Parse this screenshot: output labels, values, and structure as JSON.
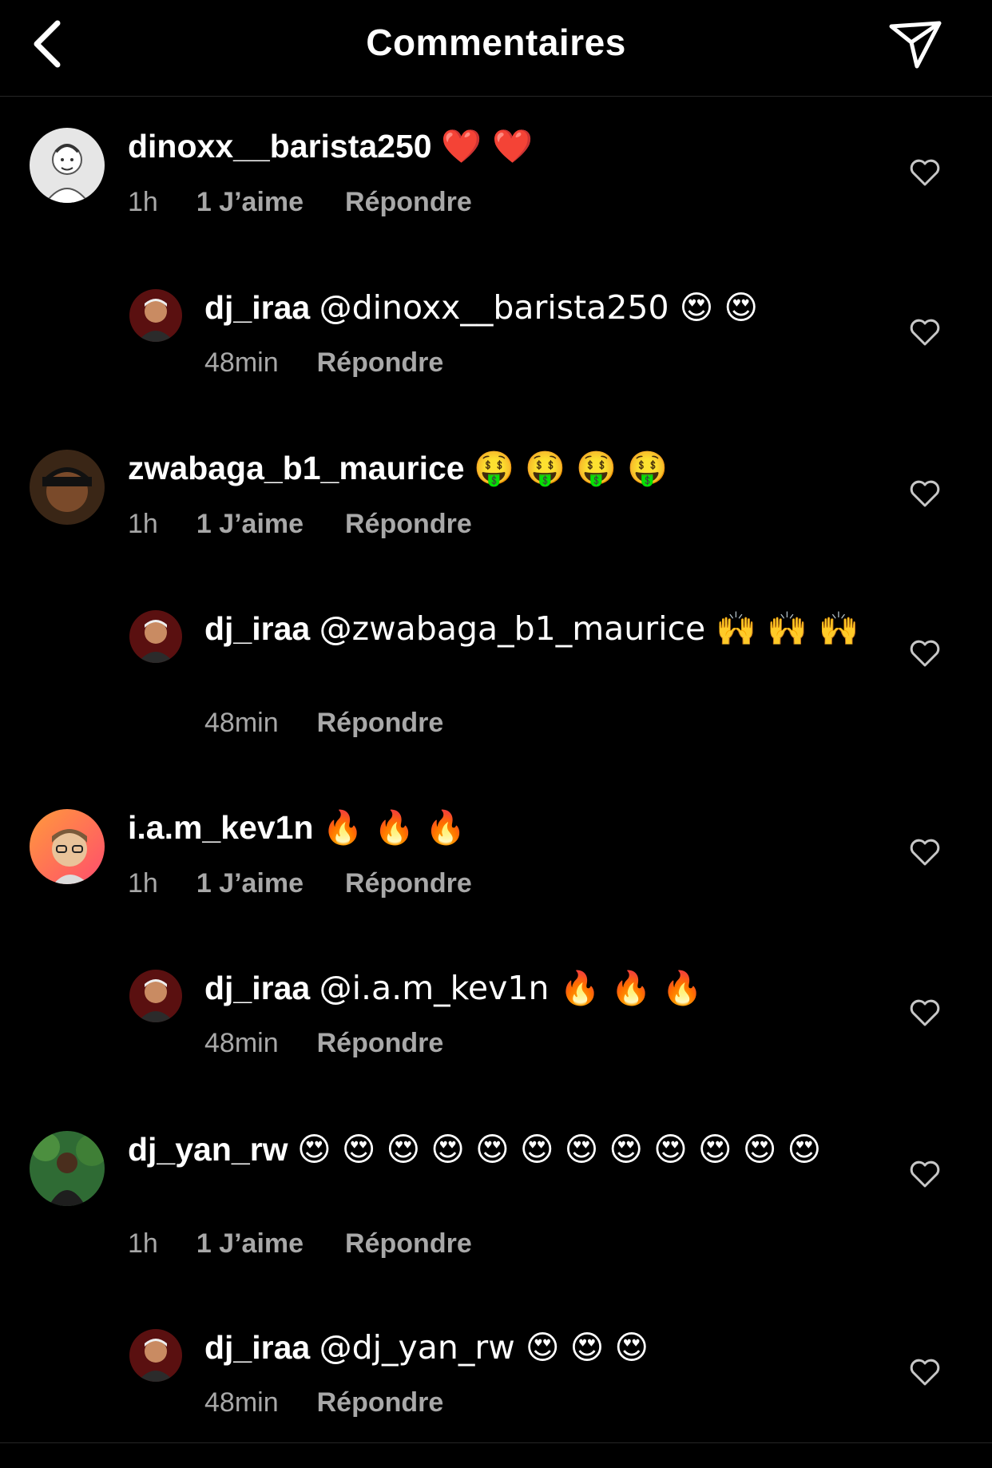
{
  "header": {
    "title": "Commentaires",
    "back_icon": "chevron-left-icon",
    "share_icon": "paper-plane-icon"
  },
  "colors": {
    "background": "#000000",
    "text": "#ffffff",
    "meta_text": "#a8a8a8",
    "divider": "#262626"
  },
  "comments": [
    {
      "username": "dinoxx__barista250",
      "body": "❤️ ❤️",
      "time": "1h",
      "likes": "1 J’aime",
      "reply_label": "Répondre",
      "avatar": "avatar-sketch"
    },
    {
      "username": "dj_iraa",
      "body": "@dinoxx__barista250 😍 😍",
      "time": "48min",
      "reply_label": "Répondre",
      "avatar": "avatar-dj-iraa"
    },
    {
      "username": "zwabaga_b1_maurice",
      "body": "🤑 🤑 🤑 🤑",
      "time": "1h",
      "likes": "1 J’aime",
      "reply_label": "Répondre",
      "avatar": "avatar-durag"
    },
    {
      "username": "dj_iraa",
      "body": "@zwabaga_b1_maurice 🙌 🙌 🙌",
      "time": "48min",
      "reply_label": "Répondre",
      "avatar": "avatar-dj-iraa"
    },
    {
      "username": "i.a.m_kev1n",
      "body": "🔥 🔥 🔥",
      "time": "1h",
      "likes": "1 J’aime",
      "reply_label": "Répondre",
      "avatar": "avatar-memoji"
    },
    {
      "username": "dj_iraa",
      "body": "@i.a.m_kev1n 🔥 🔥 🔥",
      "time": "48min",
      "reply_label": "Répondre",
      "avatar": "avatar-dj-iraa"
    },
    {
      "username": "dj_yan_rw",
      "body": "😍 😍 😍 😍 😍 😍 😍 😍 😍 😍 😍 😍",
      "time": "1h",
      "likes": "1 J’aime",
      "reply_label": "Répondre",
      "avatar": "avatar-outdoor"
    },
    {
      "username": "dj_iraa",
      "body": "@dj_yan_rw 😍 😍 😍",
      "time": "48min",
      "reply_label": "Répondre",
      "avatar": "avatar-dj-iraa"
    }
  ]
}
